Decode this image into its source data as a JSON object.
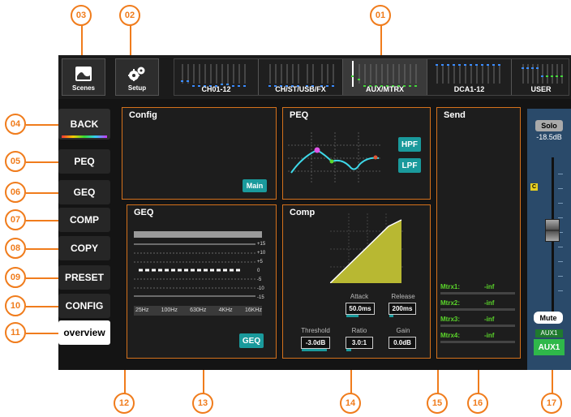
{
  "callouts": [
    "01",
    "02",
    "03",
    "04",
    "05",
    "06",
    "07",
    "08",
    "09",
    "10",
    "11",
    "12",
    "13",
    "14",
    "15",
    "16",
    "17"
  ],
  "top_buttons": {
    "scenes": "Scenes",
    "setup": "Setup"
  },
  "channel_strip": [
    "CH01-12",
    "CH/ST/USB/FX",
    "AUX/MTRX",
    "DCA1-12",
    "USER"
  ],
  "side_menu": [
    "BACK",
    "PEQ",
    "GEQ",
    "COMP",
    "COPY",
    "PRESET",
    "CONFIG",
    "overview"
  ],
  "config": {
    "title": "Config",
    "main_button": "Main"
  },
  "peq": {
    "title": "PEQ",
    "hpf": "HPF",
    "lpf": "LPF"
  },
  "geq": {
    "title": "GEQ",
    "scale": [
      "+15",
      "+10",
      "+5",
      "0",
      "-5",
      "-10",
      "-15"
    ],
    "freqs": [
      "25Hz",
      "100Hz",
      "630Hz",
      "4KHz",
      "16KHz"
    ],
    "button": "GEQ"
  },
  "comp": {
    "title": "Comp",
    "attack_label": "Attack",
    "attack_value": "50.0ms",
    "attack_level": 0.45,
    "release_label": "Release",
    "release_value": "200ms",
    "release_level": 0.15,
    "threshold_label": "Threshold",
    "threshold_value": "-3.0dB",
    "threshold_level": 0.9,
    "ratio_label": "Ratio",
    "ratio_value": "3.0:1",
    "ratio_level": 0.2,
    "gain_label": "Gain",
    "gain_value": "0.0dB",
    "gain_level": 0.0
  },
  "send": {
    "title": "Send",
    "rows": [
      {
        "name": "Mtrx1:",
        "value": "-inf"
      },
      {
        "name": "Mtrx2:",
        "value": "-inf"
      },
      {
        "name": "Mtrx3:",
        "value": "-inf"
      },
      {
        "name": "Mtrx4:",
        "value": "-inf"
      }
    ]
  },
  "fader": {
    "solo": "Solo",
    "level": "-18.5dB",
    "marker": "C",
    "mute": "Mute",
    "aux_small": "AUX1",
    "aux_big": "AUX1"
  },
  "colors": {
    "callout": "#f07c1c",
    "panel_border": "#d4711c",
    "teal": "#1a9a9c",
    "send_green": "#5bd62b",
    "comp_fill": "#b8b832",
    "peq_curve": "#3ed8e8"
  }
}
